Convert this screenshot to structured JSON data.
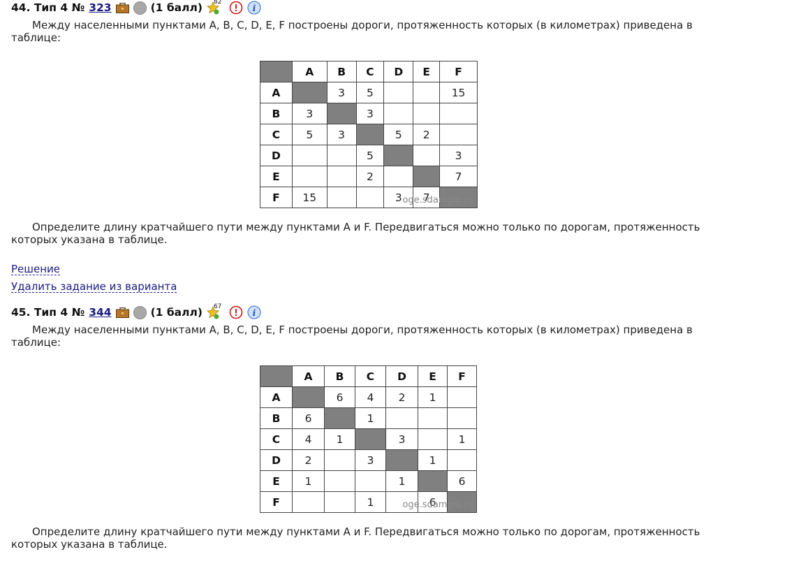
{
  "problems": [
    {
      "number_label": "44. Тип 4 №",
      "id": "323",
      "points": "(1 балл)",
      "star_count": "82",
      "statement": "Между населенными пунктами A, B, C, D, E, F построены дороги, протяженность которых (в километрах) приведена в таблице:",
      "headers": [
        "A",
        "B",
        "C",
        "D",
        "E",
        "F"
      ],
      "rows": [
        [
          "",
          "3",
          "5",
          "",
          "",
          "15"
        ],
        [
          "3",
          "",
          "3",
          "",
          "",
          ""
        ],
        [
          "5",
          "3",
          "",
          "5",
          "2",
          ""
        ],
        [
          "",
          "",
          "5",
          "",
          "",
          "3"
        ],
        [
          "",
          "",
          "2",
          "",
          "",
          "7"
        ],
        [
          "15",
          "",
          "",
          "3",
          "7",
          ""
        ]
      ],
      "watermark": "oge.sdamgia.ru",
      "question": "Определите длину кратчайшего пути между пунктами A и F. Передвигаться можно только по дорогам, протяженность которых указана в таблице."
    },
    {
      "number_label": "45. Тип 4 №",
      "id": "344",
      "points": "(1 балл)",
      "star_count": "67",
      "statement": "Между населенными пунктами A, B, C, D, E, F построены дороги, протяженность которых (в километрах) приведена в таблице:",
      "headers": [
        "A",
        "B",
        "C",
        "D",
        "E",
        "F"
      ],
      "rows": [
        [
          "",
          "6",
          "4",
          "2",
          "1",
          ""
        ],
        [
          "6",
          "",
          "1",
          "",
          "",
          ""
        ],
        [
          "4",
          "1",
          "",
          "3",
          "",
          "1"
        ],
        [
          "2",
          "",
          "3",
          "",
          "1",
          ""
        ],
        [
          "1",
          "",
          "",
          "1",
          "",
          "6"
        ],
        [
          "",
          "",
          "1",
          "",
          "6",
          ""
        ]
      ],
      "watermark": "oge.sdamgia.ru",
      "question": "Определите длину кратчайшего пути между пунктами A и F. Передвигаться можно только по дорогам, протяженность которых указана в таблице."
    }
  ],
  "links": {
    "solution": "Решение",
    "remove": "Удалить задание из варианта"
  },
  "icons": [
    "briefcase-icon",
    "circle-icon",
    "star-icon",
    "warning-icon",
    "info-icon"
  ],
  "colors": {
    "link": "#1a1a80",
    "table_diagonal": "#808080",
    "warning": "#d01818",
    "info": "#2a6ad0"
  }
}
